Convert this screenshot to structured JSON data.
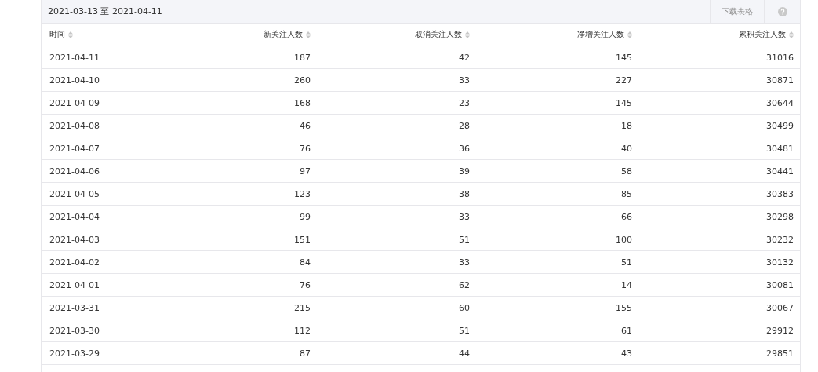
{
  "toolbar": {
    "date_range": "2021-03-13 至 2021-04-11",
    "download_button": "下载表格"
  },
  "table": {
    "columns": [
      "时间",
      "新关注人数",
      "取消关注人数",
      "净增关注人数",
      "累积关注人数"
    ],
    "rows": [
      [
        "2021-04-11",
        "187",
        "42",
        "145",
        "31016"
      ],
      [
        "2021-04-10",
        "260",
        "33",
        "227",
        "30871"
      ],
      [
        "2021-04-09",
        "168",
        "23",
        "145",
        "30644"
      ],
      [
        "2021-04-08",
        "46",
        "28",
        "18",
        "30499"
      ],
      [
        "2021-04-07",
        "76",
        "36",
        "40",
        "30481"
      ],
      [
        "2021-04-06",
        "97",
        "39",
        "58",
        "30441"
      ],
      [
        "2021-04-05",
        "123",
        "38",
        "85",
        "30383"
      ],
      [
        "2021-04-04",
        "99",
        "33",
        "66",
        "30298"
      ],
      [
        "2021-04-03",
        "151",
        "51",
        "100",
        "30232"
      ],
      [
        "2021-04-02",
        "84",
        "33",
        "51",
        "30132"
      ],
      [
        "2021-04-01",
        "76",
        "62",
        "14",
        "30081"
      ],
      [
        "2021-03-31",
        "215",
        "60",
        "155",
        "30067"
      ],
      [
        "2021-03-30",
        "112",
        "51",
        "61",
        "29912"
      ],
      [
        "2021-03-29",
        "87",
        "44",
        "43",
        "29851"
      ]
    ]
  }
}
